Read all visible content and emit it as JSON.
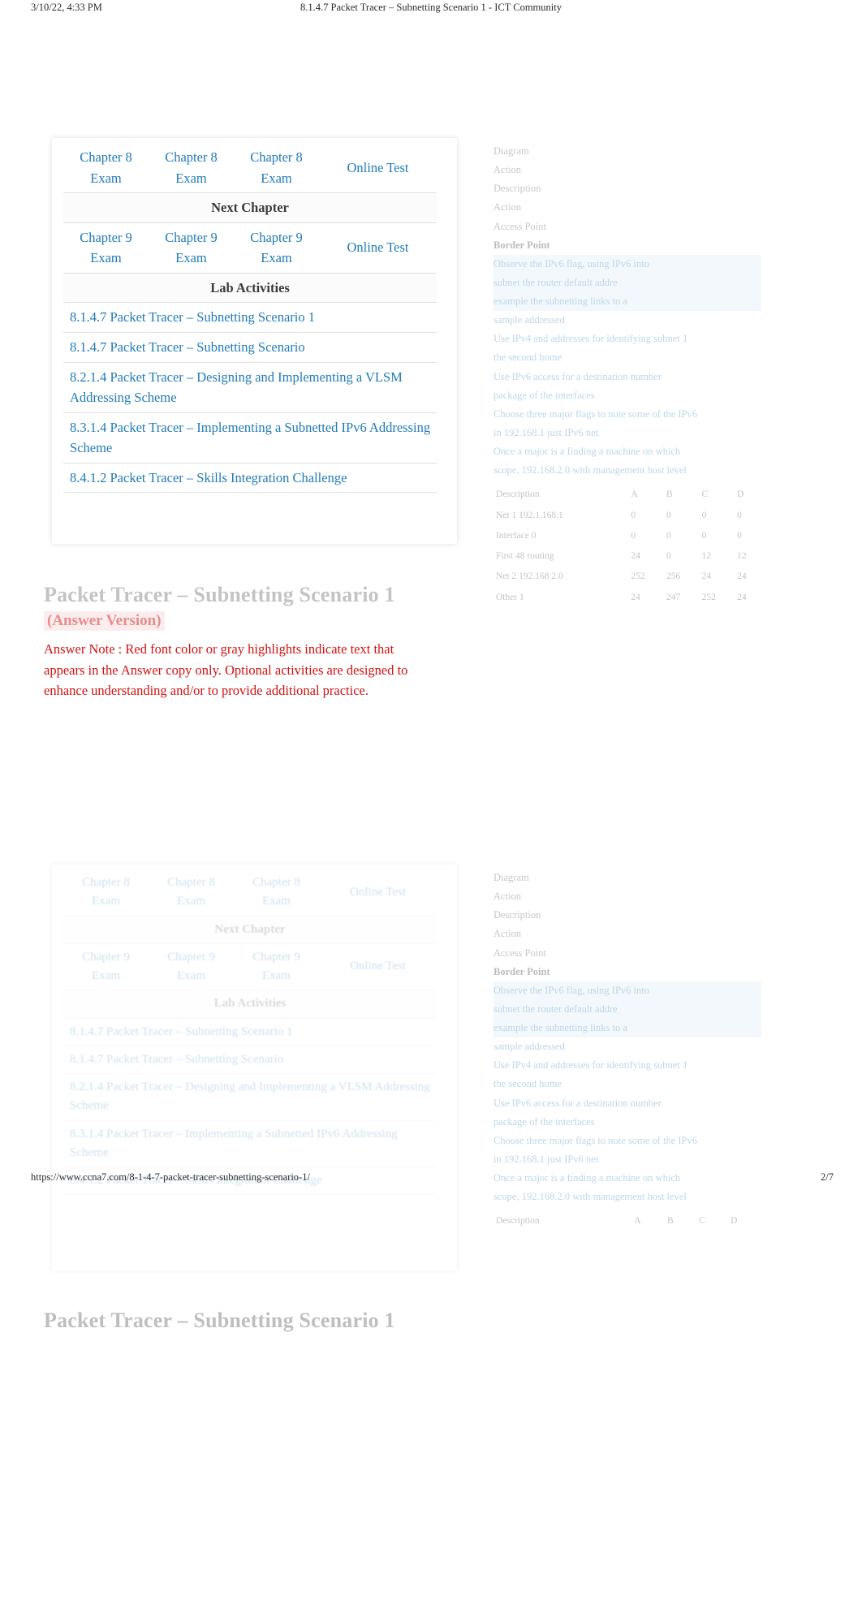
{
  "print_header": {
    "date": "3/10/22, 4:33 PM",
    "title": "8.1.4.7 Packet Tracer – Subnetting Scenario 1 - ICT Community"
  },
  "print_footer": {
    "url": "https://www.ccna7.com/8-1-4-7-packet-tracer-subnetting-scenario-1/",
    "page": "2/7"
  },
  "nav_table": {
    "section_headings": {
      "next_chapter": "Next Chapter",
      "lab_activities": "Lab Activities"
    },
    "exam_rows": [
      {
        "cells": [
          "Chapter 8 Exam",
          "Chapter 8 Exam",
          "Chapter 8 Exam",
          "Online Test"
        ]
      },
      {
        "cells": [
          "Chapter 9 Exam",
          "Chapter 9 Exam",
          "Chapter 9 Exam",
          "Online Test"
        ]
      }
    ],
    "lab_links": [
      "8.1.4.7 Packet Tracer – Subnetting Scenario 1",
      "8.1.4.7 Packet Tracer – Subnetting Scenario",
      "8.2.1.4 Packet Tracer – Designing and Implementing a VLSM Addressing Scheme",
      "8.3.1.4 Packet Tracer – Implementing a Subnetted IPv6 Addressing Scheme",
      "8.4.1.2 Packet Tracer – Skills Integration Challenge"
    ]
  },
  "document": {
    "title": "Packet Tracer – Subnetting Scenario 1",
    "subtitle": "(Answer Version)",
    "answer_note_label": "Answer Note",
    "answer_note_text": ": Red font color or gray highlights indicate text that appears in the Answer copy only. Optional activities are designed to enhance understanding and/or to provide additional practice."
  },
  "side_panel": {
    "lines": [
      "Diagram",
      "Action",
      "Description",
      "Action",
      "Access Point",
      "Border Point"
    ],
    "body_lines": [
      "Observe the IPv6 flag, using IPv6 into",
      "subnet the router default addre",
      "example the subnetting links to a",
      "sample addressed",
      "Use IPv4 and addresses for identifying subnet 1",
      "the second home",
      "Use IPv6 access for a destination number",
      "package of the interfaces",
      "Choose three major flags to note some of the IPv6",
      "in 192.168.1 just IPv6 net",
      "Once a major is a finding a machine on which",
      "scope, 192.168.2.0 with management host level"
    ],
    "table": {
      "headers": [
        "Description",
        "A",
        "B",
        "C",
        "D"
      ],
      "rows": [
        [
          "Net 1 192.1.168.1",
          "0",
          "0",
          "0",
          "0"
        ],
        [
          "Interface 0",
          "0",
          "0",
          "0",
          "0"
        ],
        [
          "First 48 routing",
          "24",
          "0",
          "12",
          "12"
        ],
        [
          "Net 2 192.168.2.0",
          "252",
          "256",
          "24",
          "24"
        ],
        [
          "Other 1",
          "24",
          "247",
          "252",
          "24"
        ]
      ]
    }
  }
}
